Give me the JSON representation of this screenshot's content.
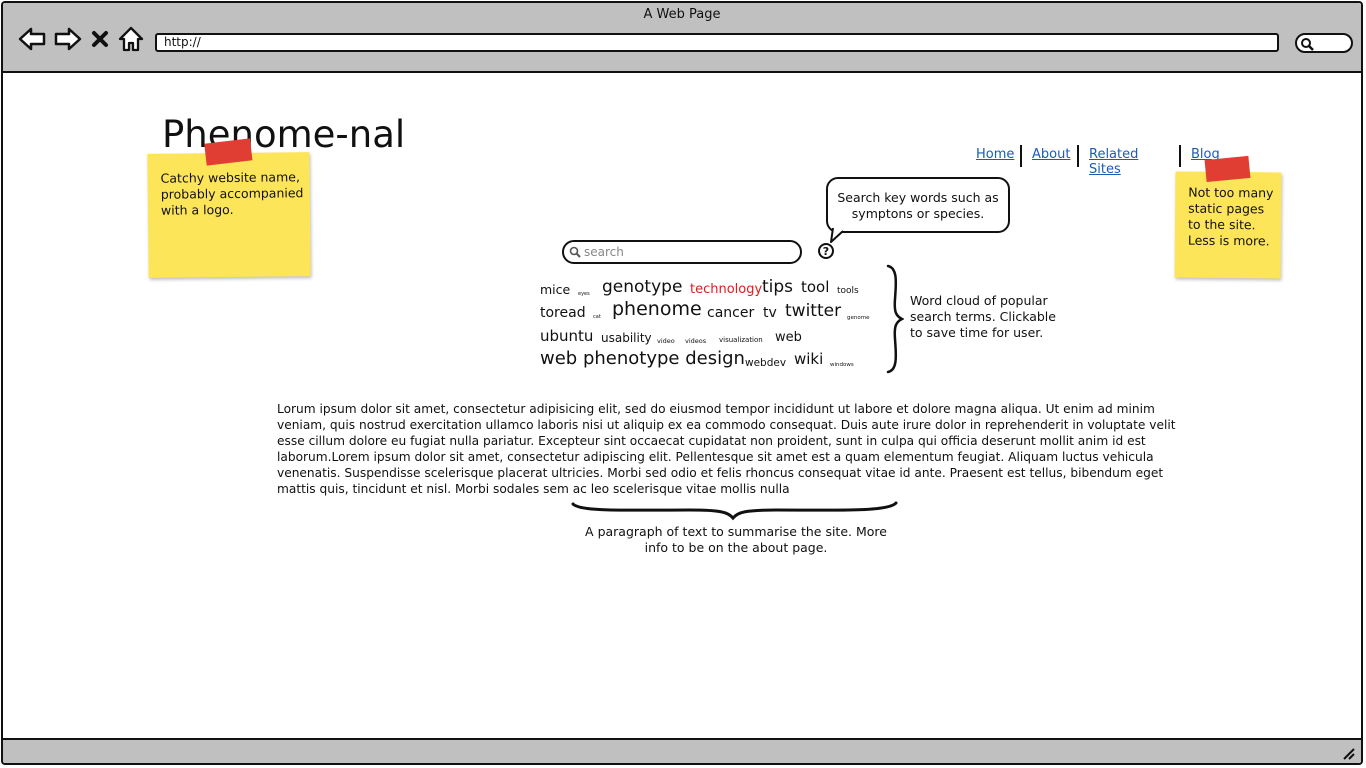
{
  "browser": {
    "window_title": "A Web Page",
    "url": "http://"
  },
  "site": {
    "logo": "Phenome-nal",
    "nav": [
      "Home",
      "About",
      "Related Sites",
      "Blog"
    ],
    "search_placeholder": "search",
    "help_label": "?",
    "word_cloud": [
      {
        "text": "mice",
        "color": "#111111"
      },
      {
        "text": "eyes",
        "color": "#111111"
      },
      {
        "text": "genotype",
        "color": "#111111"
      },
      {
        "text": "technology",
        "color": "#e01b1b"
      },
      {
        "text": "tips",
        "color": "#111111"
      },
      {
        "text": "tool",
        "color": "#111111"
      },
      {
        "text": "tools",
        "color": "#111111"
      },
      {
        "text": "toread",
        "color": "#111111"
      },
      {
        "text": "cat",
        "color": "#111111"
      },
      {
        "text": "phenome",
        "color": "#111111"
      },
      {
        "text": "cancer",
        "color": "#111111"
      },
      {
        "text": "tv",
        "color": "#111111"
      },
      {
        "text": "twitter",
        "color": "#111111"
      },
      {
        "text": "genome",
        "color": "#111111"
      },
      {
        "text": "ubuntu",
        "color": "#111111"
      },
      {
        "text": "usability",
        "color": "#111111"
      },
      {
        "text": "video",
        "color": "#111111"
      },
      {
        "text": "videos",
        "color": "#111111"
      },
      {
        "text": "visualization",
        "color": "#111111"
      },
      {
        "text": "web",
        "color": "#111111"
      },
      {
        "text": "web phenotype design",
        "color": "#111111"
      },
      {
        "text": "webdev",
        "color": "#111111"
      },
      {
        "text": "wiki",
        "color": "#111111"
      },
      {
        "text": "windows",
        "color": "#111111"
      }
    ],
    "paragraph": "Lorum ipsum dolor sit amet, consectetur adipisicing elit, sed do eiusmod tempor incididunt ut labore et dolore magna aliqua. Ut enim ad minim veniam, quis nostrud exercitation ullamco laboris nisi ut aliquip ex ea commodo consequat. Duis aute irure dolor in reprehenderit in voluptate velit esse cillum dolore eu fugiat nulla pariatur. Excepteur sint occaecat cupidatat non proident, sunt in culpa qui officia deserunt mollit anim id est laborum.Lorem ipsum dolor sit amet, consectetur adipiscing elit. Pellentesque sit amet est a quam elementum feugiat. Aliquam luctus vehicula venenatis. Suspendisse scelerisque placerat ultricies. Morbi sed odio et felis rhoncus consequat vitae id ante. Praesent est tellus, bibendum eget mattis quis, tincidunt et nisl. Morbi sodales sem ac leo scelerisque vitae mollis nulla"
  },
  "annotations": {
    "logo_note": "Catchy website name, probably accompanied with a logo.",
    "nav_note": "Not too many static pages to the site. Less is more.",
    "search_note": "Search key words such as symptons or species.",
    "cloud_note": "Word cloud of popular search terms. Clickable to save time for user.",
    "paragraph_note": "A paragraph of text to summarise the site. More info to be on the about page."
  }
}
